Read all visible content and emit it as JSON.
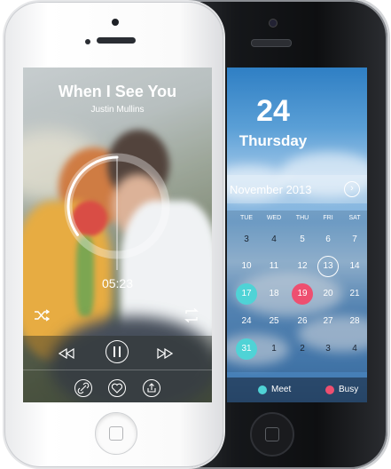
{
  "music": {
    "title": "When I See You",
    "artist": "Justin Mullins",
    "time": "05:23",
    "progress": 0.35,
    "icons": [
      "shuffle-icon",
      "repeat-icon",
      "rewind-icon",
      "pause-icon",
      "fast-forward-icon",
      "link-icon",
      "heart-icon",
      "share-icon"
    ]
  },
  "calendar": {
    "day_number": "24",
    "weekday": "Thursday",
    "month_label": "November 2013",
    "weekdays": [
      "TUE",
      "WED",
      "THU",
      "FRI",
      "SAT"
    ],
    "rows": [
      [
        "3",
        "4",
        "5",
        "6",
        "7"
      ],
      [
        "10",
        "11",
        "12",
        "13",
        "14"
      ],
      [
        "17",
        "18",
        "19",
        "20",
        "21"
      ],
      [
        "24",
        "25",
        "26",
        "27",
        "28"
      ],
      [
        "31",
        "1",
        "2",
        "3",
        "4"
      ]
    ],
    "legend": {
      "meet": "Meet",
      "busy": "Busy"
    },
    "colors": {
      "meet": "#4fd3d6",
      "busy": "#ee4f70"
    }
  }
}
